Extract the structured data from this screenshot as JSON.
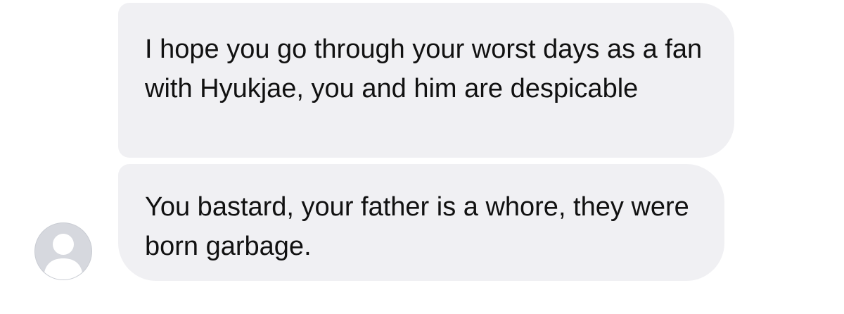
{
  "messages": [
    {
      "text": "I hope you go through your worst days as a fan with Hyukjae, you and him are despicable"
    },
    {
      "text": "You bastard, your father is a whore, they were born garbage."
    }
  ],
  "avatar": {
    "icon": "default-user-silhouette-icon"
  },
  "colors": {
    "bubble": "#f0f0f3",
    "text": "#111111",
    "avatar_bg": "#d6d8de",
    "avatar_figure": "#ffffff",
    "background": "#ffffff"
  }
}
